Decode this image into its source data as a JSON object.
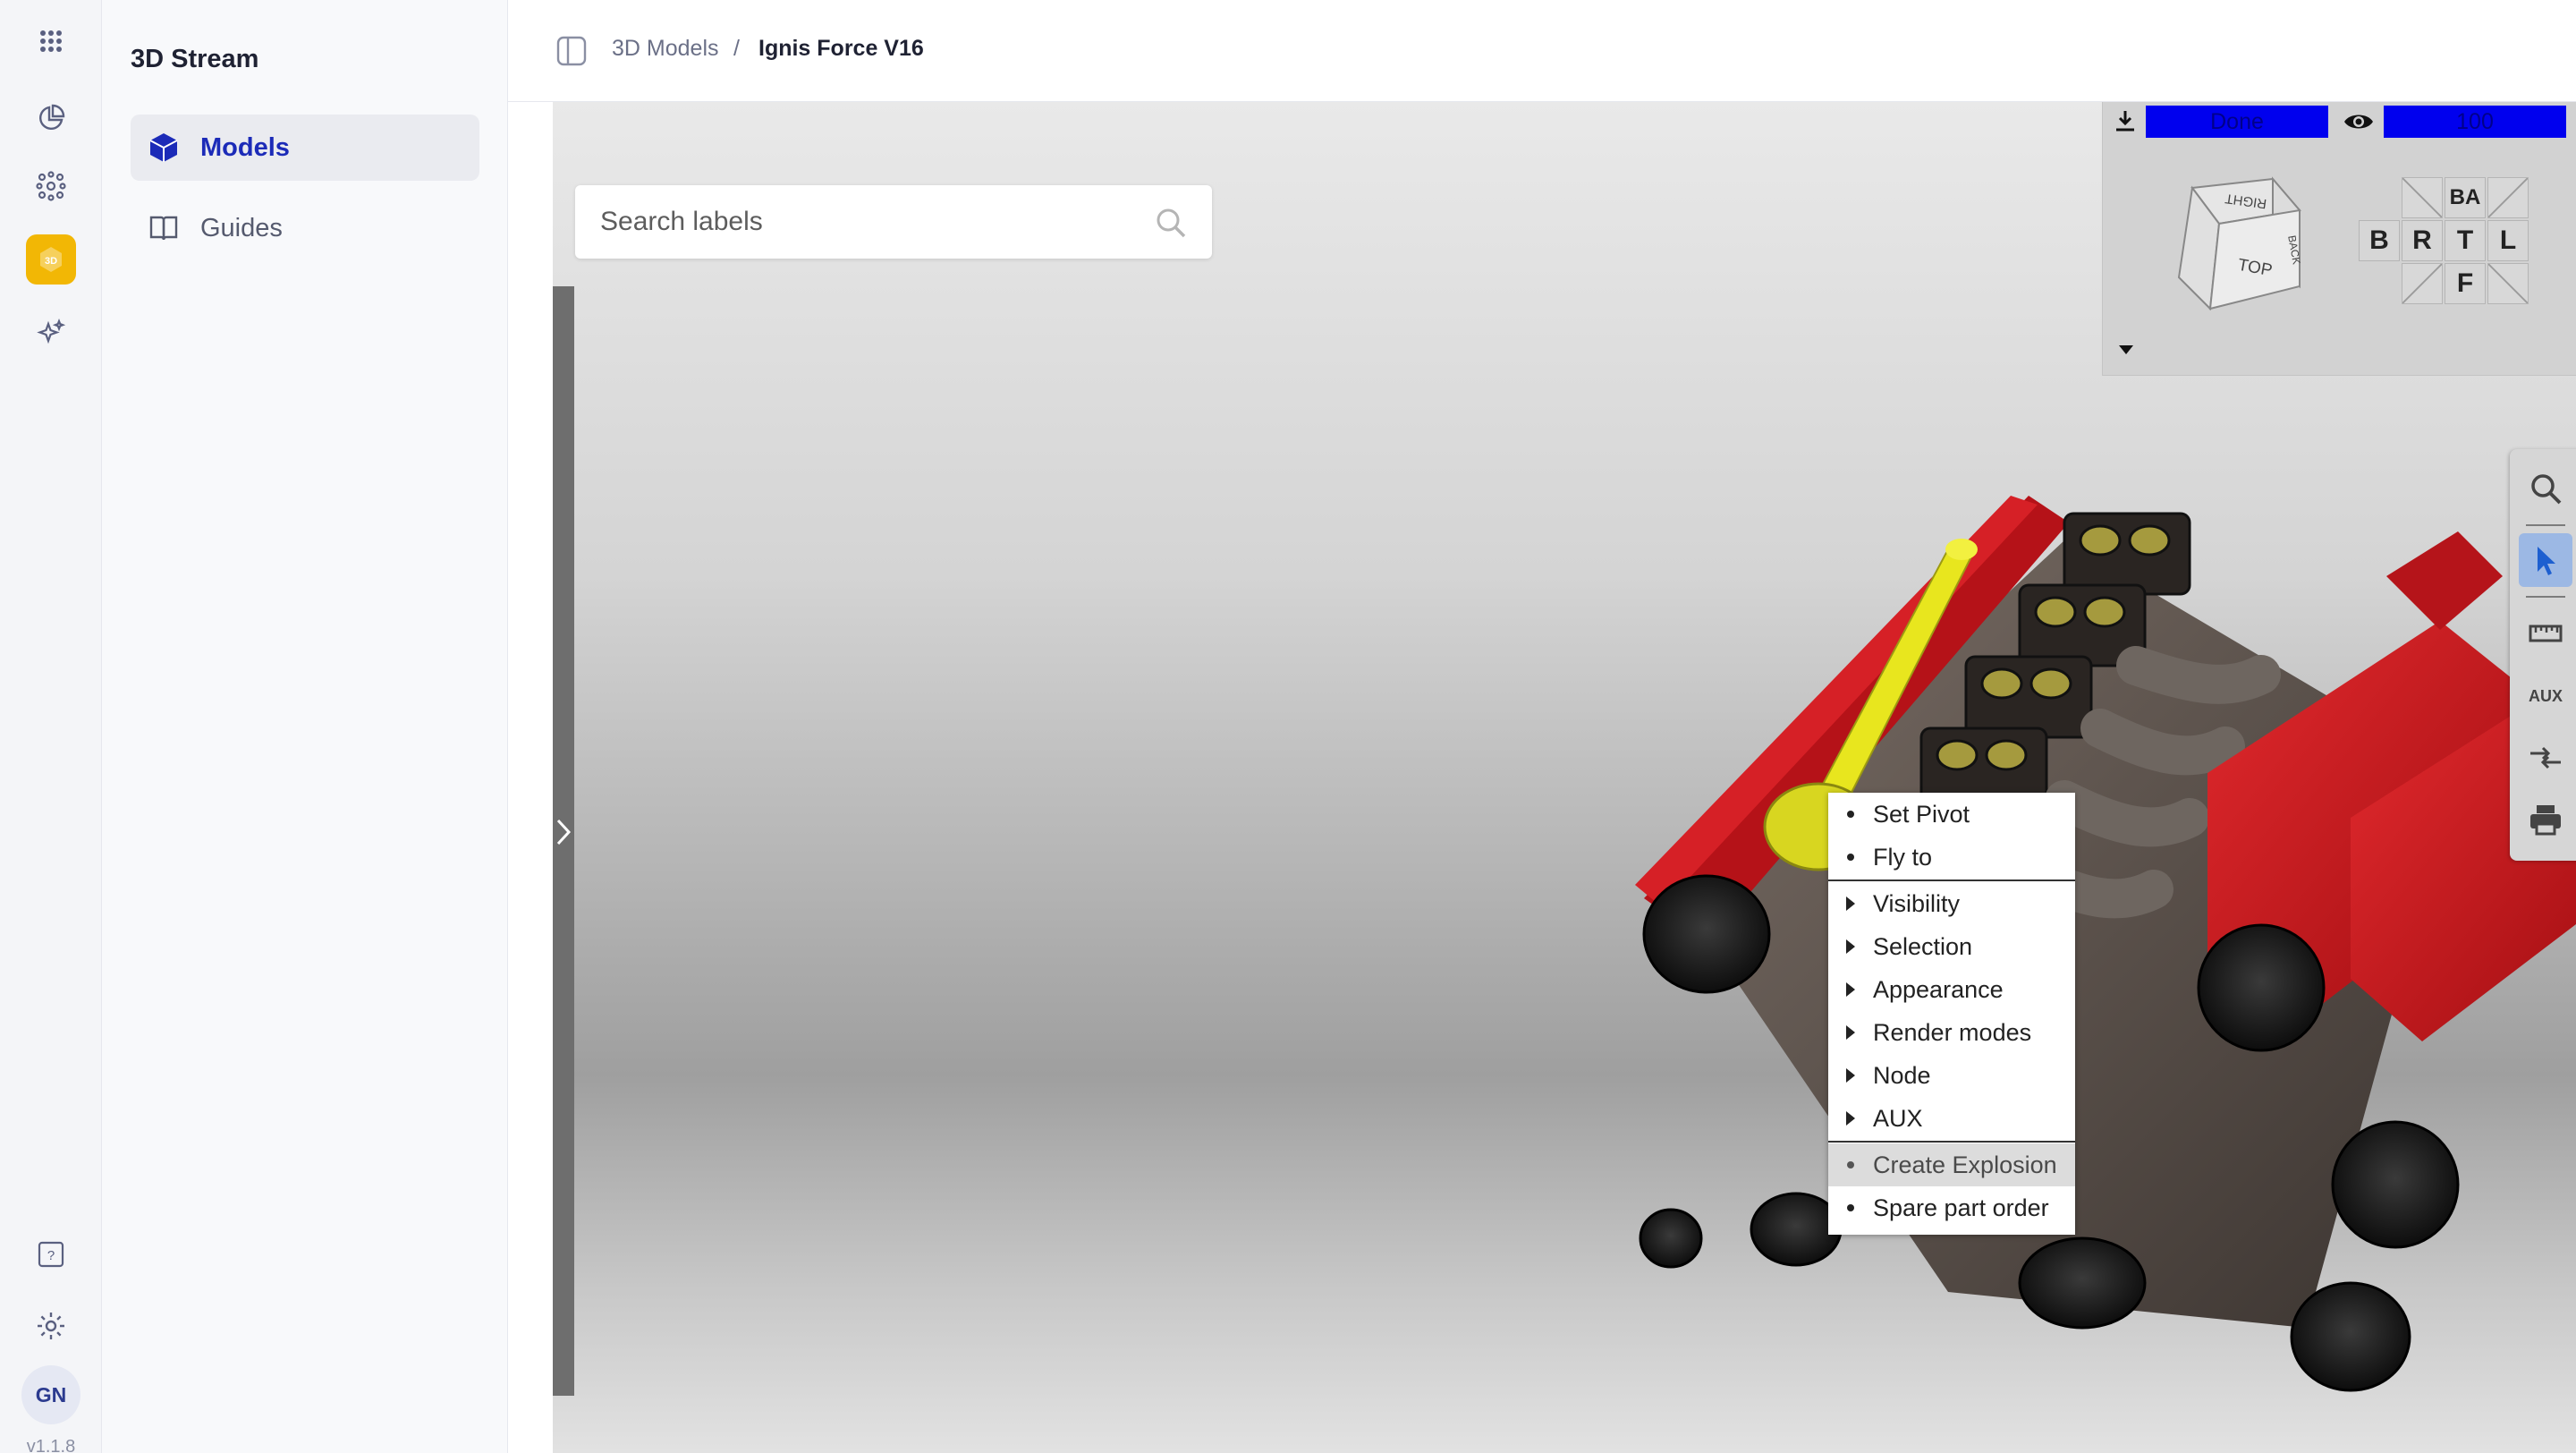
{
  "app": {
    "title": "3D Stream",
    "version": "v1.1.8",
    "user_initials": "GN"
  },
  "rail": {
    "icons": [
      "apps-grid-icon",
      "analytics-icon",
      "network-icon",
      "3d-icon",
      "sparkles-icon"
    ],
    "active": "3d-icon",
    "active_badge_label": "3D",
    "bottom_icons": [
      "help-icon",
      "settings-icon"
    ]
  },
  "sidebar": {
    "items": [
      {
        "label": "Models",
        "icon": "cube-icon",
        "active": true
      },
      {
        "label": "Guides",
        "icon": "book-icon",
        "active": false
      }
    ]
  },
  "breadcrumb": {
    "parent": "3D Models",
    "separator": "/",
    "current": "Ignis Force V16"
  },
  "search": {
    "placeholder": "Search labels"
  },
  "nav_panel": {
    "status_text": "Done",
    "opacity_value": "100",
    "cube_faces": {
      "top": "TOP",
      "right": "RIGHT",
      "back": "BACK"
    },
    "view_buttons": [
      "BA",
      "B",
      "R",
      "T",
      "L",
      "F"
    ]
  },
  "right_toolbar": {
    "tools": [
      "search-icon",
      "pointer-icon",
      "ruler-icon",
      "AUX",
      "compare-icon",
      "print-icon"
    ],
    "active": "pointer-icon"
  },
  "context_menu": {
    "items": [
      {
        "label": "Set Pivot",
        "type": "action"
      },
      {
        "label": "Fly to",
        "type": "action"
      },
      {
        "label": "Visibility",
        "type": "submenu"
      },
      {
        "label": "Selection",
        "type": "submenu"
      },
      {
        "label": "Appearance",
        "type": "submenu"
      },
      {
        "label": "Render modes",
        "type": "submenu"
      },
      {
        "label": "Node",
        "type": "submenu"
      },
      {
        "label": "AUX",
        "type": "submenu"
      },
      {
        "label": "Create Explosion",
        "type": "action",
        "highlighted": true
      },
      {
        "label": "Spare part order",
        "type": "action"
      }
    ]
  },
  "colors": {
    "accent": "#1c2bb8",
    "active_rail": "#f2b705",
    "status_bar": "#0000ee",
    "model_red": "#c8141a",
    "model_selected": "#e8e61e"
  }
}
